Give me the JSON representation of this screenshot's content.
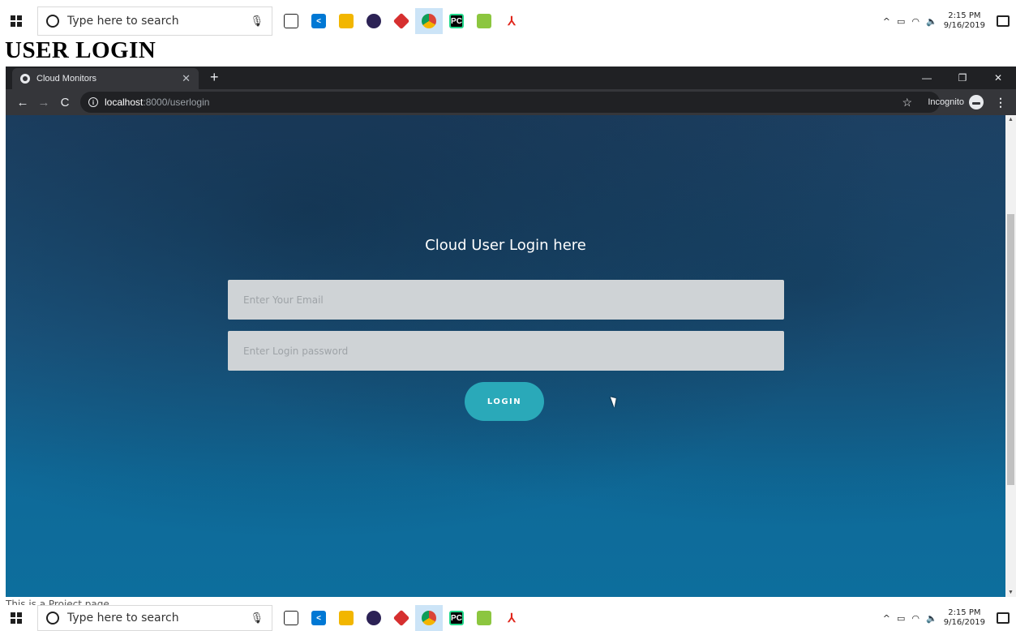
{
  "taskbar": {
    "search_placeholder": "Type here to search",
    "time": "2:15 PM",
    "date": "9/16/2019",
    "apps": [
      {
        "name": "task-view",
        "color": "#1f1f1f",
        "glyph": "⧉"
      },
      {
        "name": "vscode",
        "color": "#0078d4",
        "glyph": "⟨⟩"
      },
      {
        "name": "file-explorer",
        "color": "#f2b600",
        "glyph": ""
      },
      {
        "name": "eclipse",
        "color": "#2c2255",
        "glyph": ""
      },
      {
        "name": "git-kraken",
        "color": "#d62f2f",
        "glyph": ""
      },
      {
        "name": "chrome",
        "color": "#f4b400",
        "glyph": ""
      },
      {
        "name": "pycharm",
        "color": "#21d789",
        "glyph": "PC"
      },
      {
        "name": "notepad-plus",
        "color": "#8cc63f",
        "glyph": ""
      },
      {
        "name": "acrobat",
        "color": "#e0251b",
        "glyph": "A"
      }
    ]
  },
  "page_heading": "USER LOGIN",
  "browser": {
    "tab_title": "Cloud Monitors",
    "url_host": "localhost",
    "url_rest": ":8000/userlogin",
    "incognito_label": "Incognito"
  },
  "login": {
    "title": "Cloud User Login here",
    "email_placeholder": "Enter Your Email",
    "password_placeholder": "Enter Login password",
    "button_label": "LOGIN"
  },
  "footer_text": "This is a Project page"
}
